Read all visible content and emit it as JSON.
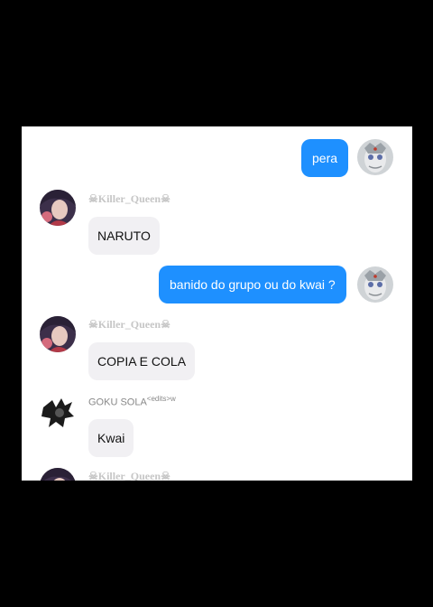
{
  "chat": {
    "messages": [
      {
        "sender": "me",
        "text": "pera"
      },
      {
        "sender": "☠Killer_Queen☠",
        "text": "NARUTO"
      },
      {
        "sender": "me",
        "text": "banido do grupo ou do kwai ?"
      },
      {
        "sender": "☠Killer_Queen☠",
        "text": "COPIA E COLA"
      },
      {
        "sender": "GOKU SOLA",
        "sender_suffix_top": "<edits",
        "sender_suffix_bottom": ">w",
        "text": "Kwai"
      },
      {
        "sender": "☠Killer_Queen☠",
        "text": ""
      }
    ]
  },
  "colors": {
    "outgoing_bubble": "#1e90ff",
    "incoming_bubble": "#f1f0f3",
    "backdrop": "#000000"
  },
  "icons": {
    "me_avatar": "masked-face-avatar",
    "killer_queen_avatar": "anime-girl-avatar",
    "goku_avatar": "dark-figure-avatar"
  }
}
